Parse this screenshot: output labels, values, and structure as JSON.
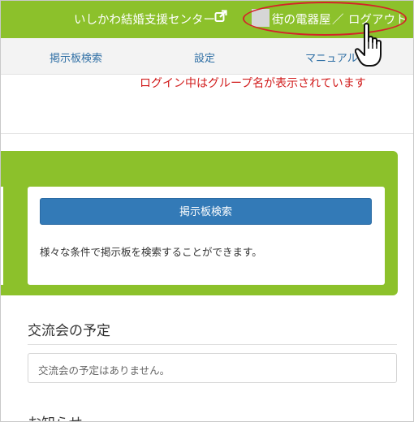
{
  "header": {
    "site_title": "いしかわ結婚支援センター",
    "group_name": "街の電器屋",
    "separator": "／",
    "logout_label": "ログアウト"
  },
  "nav": {
    "items": [
      "掲示板検索",
      "設定",
      "マニュアル"
    ]
  },
  "annotation": "ログイン中はグループ名が表示されています",
  "search_card": {
    "button_label": "掲示板検索",
    "description": "様々な条件で掲示板を検索することができます。"
  },
  "events": {
    "title": "交流会の予定",
    "empty_message": "交流会の予定はありません。"
  },
  "news": {
    "title": "お知らせ"
  },
  "colors": {
    "brand_green": "#8cc12b",
    "nav_link": "#2f6fa5",
    "primary_button": "#337ab7",
    "annotation_red": "#d11b1b"
  }
}
